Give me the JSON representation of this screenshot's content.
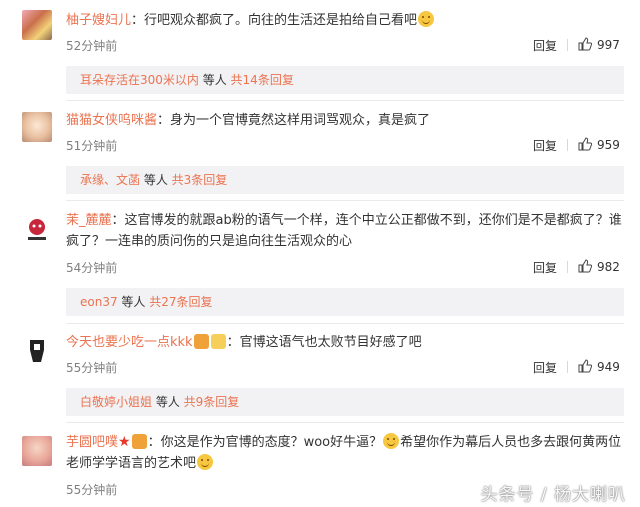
{
  "comments": [
    {
      "user": "柚子嫂妇儿",
      "text": "：行吧观众都疯了。向往的生活还是拍给自己看吧",
      "time": "52分钟前",
      "reply": "回复",
      "likes": "997",
      "sub": {
        "names": "耳朵存活在300米以内",
        "mid": " 等人 ",
        "count": "共14条回复"
      }
    },
    {
      "user": "猫猫女侠呜咪酱",
      "text": "：身为一个官博竟然这样用词骂观众，真是疯了",
      "time": "51分钟前",
      "reply": "回复",
      "likes": "959",
      "sub": {
        "names": "承缘、文菡",
        "mid": " 等人 ",
        "count": "共3条回复"
      }
    },
    {
      "user": "茉_麓麓",
      "text": "：这官博发的就跟ab粉的语气一个样，连个中立公正都做不到，还你们是不是都疯了？谁疯了？一连串的质问伤的只是追向往生活观众的心",
      "time": "54分钟前",
      "reply": "回复",
      "likes": "982",
      "sub": {
        "names": "eon37",
        "mid": " 等人 ",
        "count": "共27条回复"
      }
    },
    {
      "user": "今天也要少吃一点kkk",
      "text": "：官博这语气也太败节目好感了吧",
      "time": "55分钟前",
      "reply": "回复",
      "likes": "949",
      "sub": {
        "names": "白敬婷小姐姐",
        "mid": " 等人 ",
        "count": "共9条回复"
      }
    },
    {
      "user": "芋圆吧噗",
      "text_a": "：你这是作为官博的态度？woo好牛逼？",
      "text_b": "希望你作为幕后人员也多去跟何黄两位老师学学语言的艺术吧",
      "time": "55分钟前"
    }
  ],
  "watermark": "头条号 / 杨大喇叭",
  "colors": {
    "accent": "#eb7350",
    "muted": "#808080",
    "subbg": "#f2f2f5"
  }
}
